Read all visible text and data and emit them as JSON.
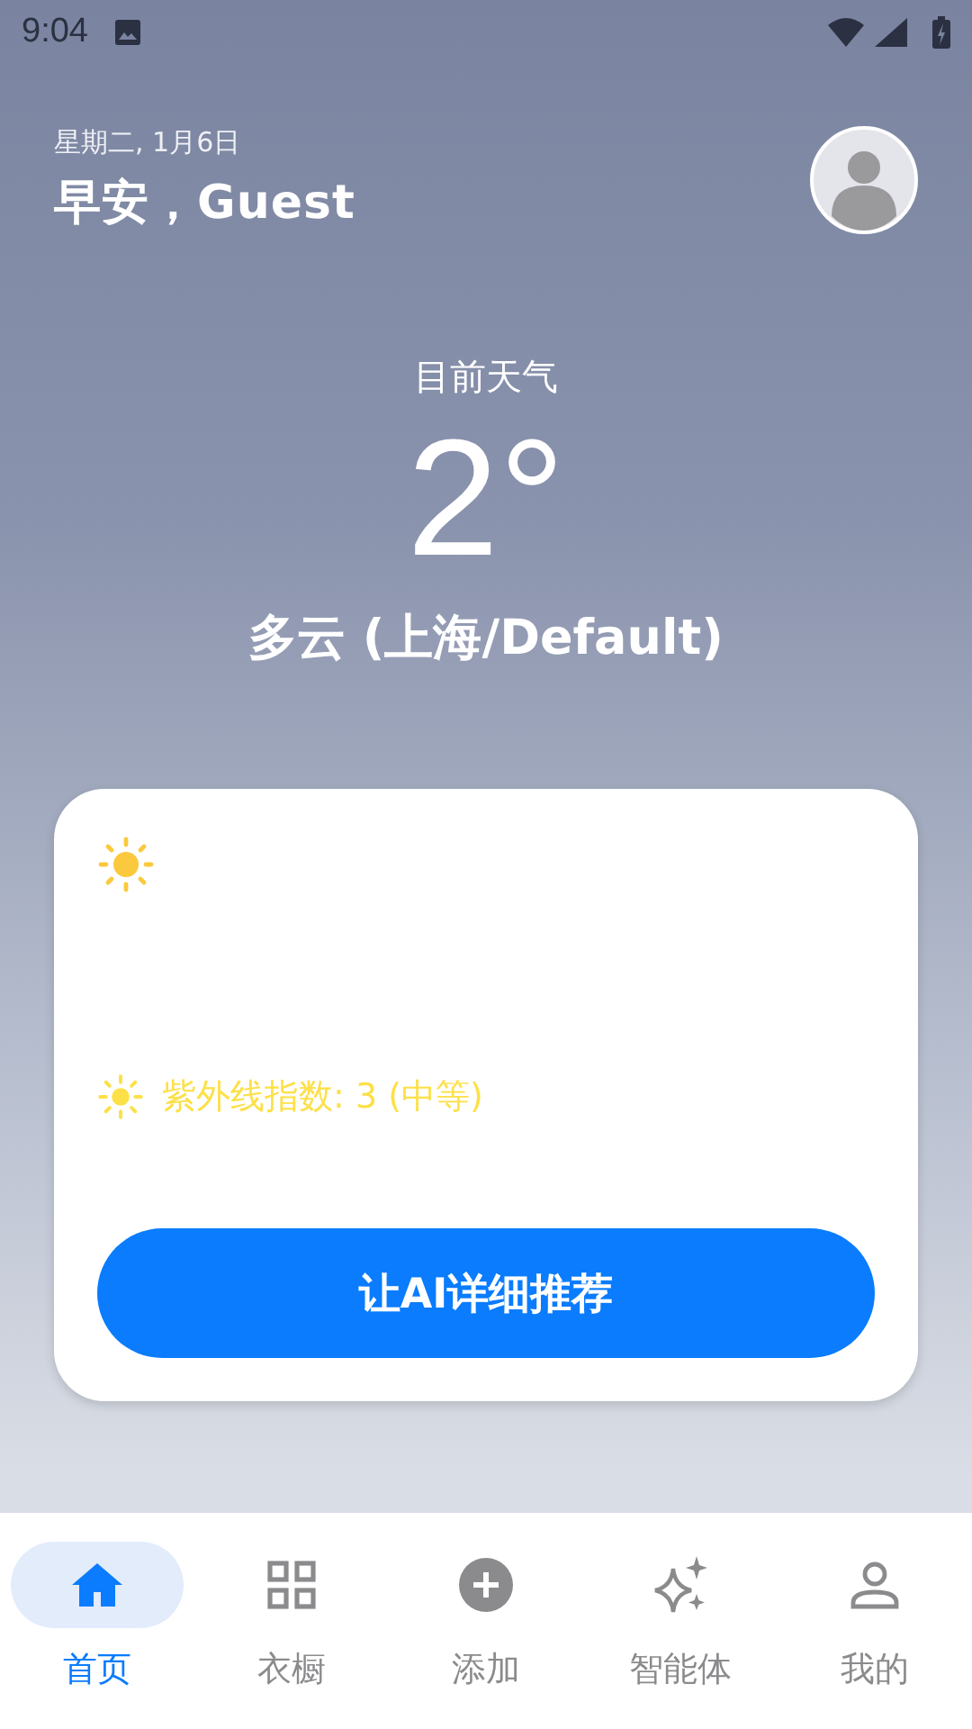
{
  "status_bar": {
    "time": "9:04"
  },
  "header": {
    "date": "星期二, 1月6日",
    "greeting": "早安，Guest"
  },
  "weather": {
    "label": "目前天气",
    "temperature": "2°",
    "condition": "多云 (上海/Default)"
  },
  "card": {
    "uv_text": "紫外线指数: 3 (中等)",
    "button": "让AI详细推荐"
  },
  "nav": [
    {
      "label": "首页",
      "kind": "home",
      "selected": true
    },
    {
      "label": "衣橱",
      "kind": "wardrobe",
      "selected": false
    },
    {
      "label": "添加",
      "kind": "add",
      "selected": false
    },
    {
      "label": "智能体",
      "kind": "agent",
      "selected": false
    },
    {
      "label": "我的",
      "kind": "profile",
      "selected": false
    }
  ]
}
